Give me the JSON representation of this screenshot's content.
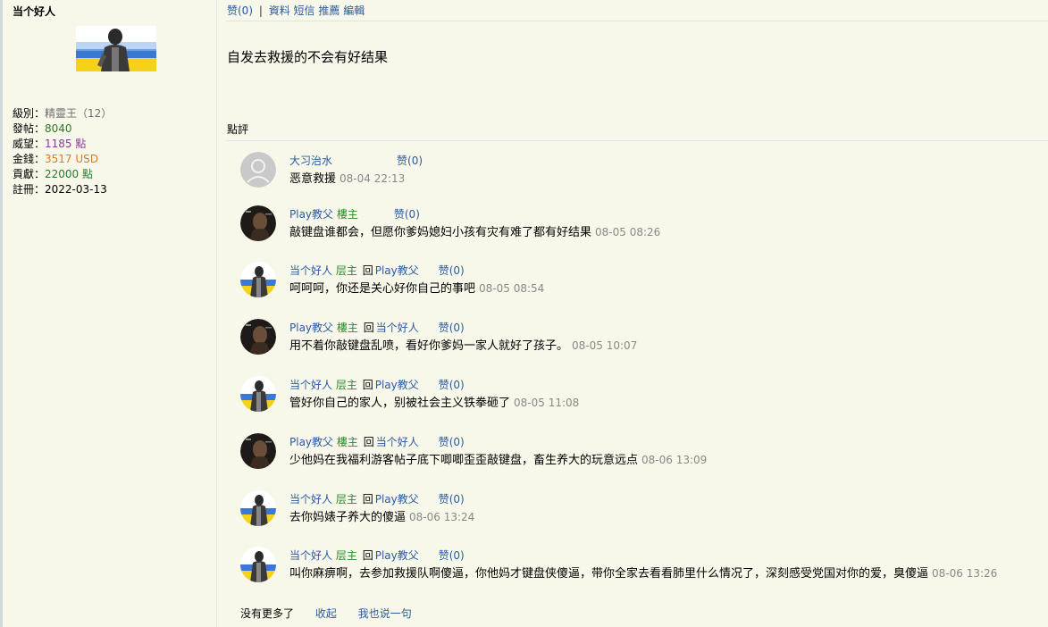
{
  "author": {
    "name": "当个好人",
    "stats": [
      {
        "label": "級別：",
        "value": "精靈王（12）",
        "color": "grey"
      },
      {
        "label": "發帖：",
        "value": "8040",
        "color": "green"
      },
      {
        "label": "威望：",
        "value": "1185 點",
        "color": "purple"
      },
      {
        "label": "金錢：",
        "value": "3517 USD",
        "color": "orange"
      },
      {
        "label": "貢獻：",
        "value": "22000 點",
        "color": "green"
      },
      {
        "label": "註冊：",
        "value": "2022-03-13",
        "color": "black"
      }
    ]
  },
  "toolbar": {
    "like": "赞(0)",
    "sep": "|",
    "profile": "資料",
    "message": "短信",
    "recommend": "推薦",
    "edit": "編輯"
  },
  "post": {
    "body": "自发去救援的不会有好结果"
  },
  "comments_header": "點評",
  "comments": [
    {
      "user": "大习治水",
      "role": "",
      "reply_word": "",
      "reply_to": "",
      "like": "赞(0)",
      "text": "恶意救援",
      "time": "08-04 22:13",
      "avatar": "default"
    },
    {
      "user": "Play教父",
      "role": "樓主",
      "reply_word": "",
      "reply_to": "",
      "like": "赞(0)",
      "text": "敲键盘谁都会，但愿你爹妈媳妇小孩有灾有难了都有好结果",
      "time": "08-05 08:26",
      "avatar": "dark"
    },
    {
      "user": "当个好人",
      "role": "层主",
      "reply_word": "回",
      "reply_to": "Play教父",
      "like": "赞(0)",
      "text": "呵呵呵，你还是关心好你自己的事吧",
      "time": "08-05 08:54",
      "avatar": "flag"
    },
    {
      "user": "Play教父",
      "role": "樓主",
      "reply_word": "回",
      "reply_to": "当个好人",
      "like": "赞(0)",
      "text": "用不着你敲键盘乱喷，看好你爹妈一家人就好了孩子。",
      "time": "08-05 10:07",
      "avatar": "dark"
    },
    {
      "user": "当个好人",
      "role": "层主",
      "reply_word": "回",
      "reply_to": "Play教父",
      "like": "赞(0)",
      "text": "管好你自己的家人，别被社会主义铁拳砸了",
      "time": "08-05 11:08",
      "avatar": "flag"
    },
    {
      "user": "Play教父",
      "role": "樓主",
      "reply_word": "回",
      "reply_to": "当个好人",
      "like": "赞(0)",
      "text": "少他妈在我福利游客帖子底下唧唧歪歪敲键盘，畜生养大的玩意远点",
      "time": "08-06 13:09",
      "avatar": "dark"
    },
    {
      "user": "当个好人",
      "role": "层主",
      "reply_word": "回",
      "reply_to": "Play教父",
      "like": "赞(0)",
      "text": "去你妈婊子养大的傻逼",
      "time": "08-06 13:24",
      "avatar": "flag"
    },
    {
      "user": "当个好人",
      "role": "层主",
      "reply_word": "回",
      "reply_to": "Play教父",
      "like": "赞(0)",
      "text": "叫你麻痹啊，去参加救援队啊傻逼，你他妈才键盘侠傻逼，带你全家去看看肺里什么情况了，深刻感受党国对你的爱，臭傻逼",
      "time": "08-06 13:26",
      "avatar": "flag"
    }
  ],
  "footer": {
    "no_more": "没有更多了",
    "collapse": "收起",
    "reply": "我也说一句"
  },
  "colors": {
    "background": "#f8f8ea",
    "link": "#2a5aa0",
    "role": "#2a8a2a"
  }
}
